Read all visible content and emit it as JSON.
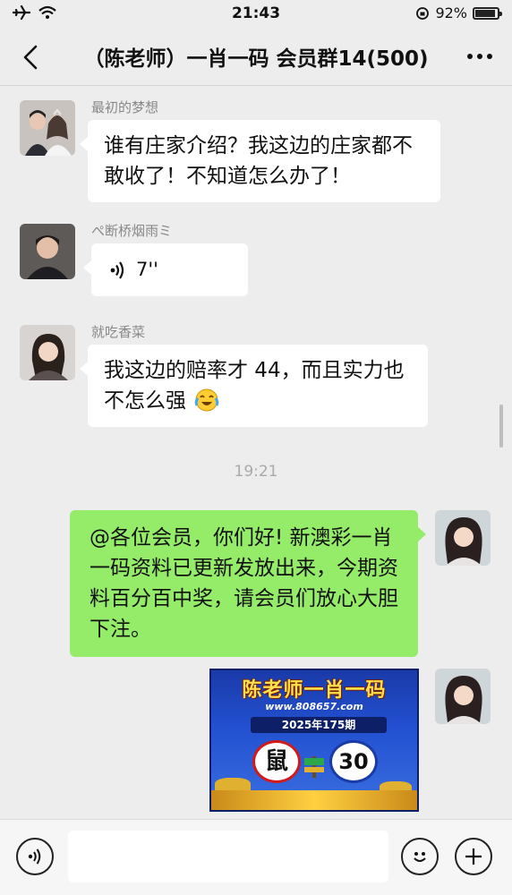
{
  "status_bar": {
    "time": "21:43",
    "battery": "92%"
  },
  "nav": {
    "title": "（陈老师）一肖一码 会员群14(500)"
  },
  "messages": [
    {
      "sender": "最初的梦想",
      "text": "谁有庄家介绍？我这边的庄家都不敢收了！不知道怎么办了！"
    },
    {
      "sender": "ぺ断桥烟雨ミ",
      "voice_duration": "7''"
    },
    {
      "sender": "就吃香菜",
      "text": "我这边的赔率才 44，而且实力也不怎么强"
    }
  ],
  "time_separator": "19:21",
  "outgoing": {
    "text": "@各位会员，你们好! 新澳彩一肖一码资料已更新发放出来，今期资料百分百中奖，请会员们放心大胆下注。"
  },
  "poster": {
    "title": "陈老师一肖一码",
    "url": "www.808657.com",
    "date": "2025年175期",
    "zodiac": "鼠",
    "number": "30"
  },
  "colors": {
    "background": "#ededed",
    "outgoing_bubble": "#95ec69",
    "incoming_bubble": "#ffffff"
  }
}
